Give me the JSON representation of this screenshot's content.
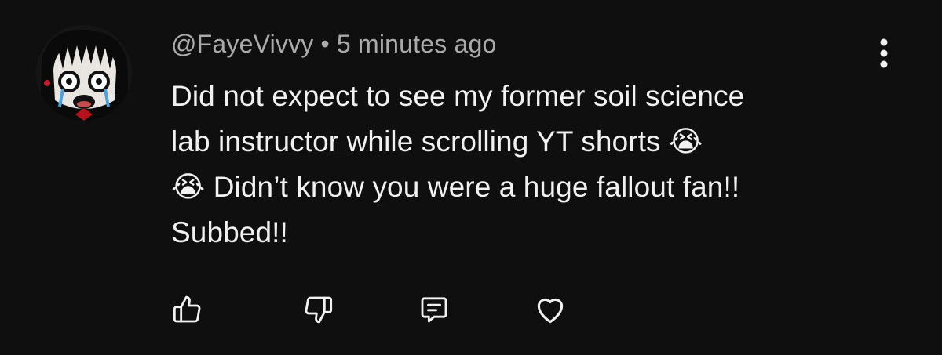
{
  "comment": {
    "author": "@FayeVivvy",
    "separator": "•",
    "timestamp": "5 minutes ago",
    "text": "Did not expect to see my former soil science\nlab instructor while scrolling YT shorts 😭\n😭 Didn’t know you were a huge fallout fan!!\nSubbed!!"
  },
  "icons": {
    "menu": "more-vertical-icon",
    "like": "thumbs-up-icon",
    "dislike": "thumbs-down-icon",
    "reply": "comment-icon",
    "heart": "heart-icon"
  },
  "colors": {
    "background": "#0f0f0f",
    "primary_text": "#f1f1f1",
    "secondary_text": "#aaaaaa"
  }
}
